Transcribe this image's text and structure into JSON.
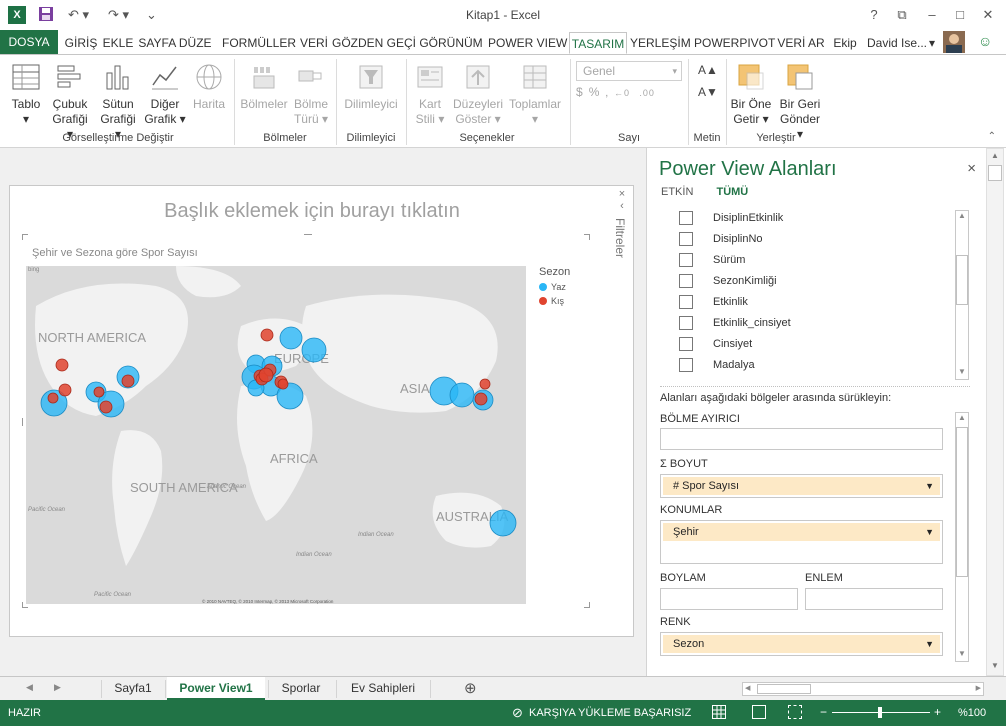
{
  "window": {
    "title": "Kitap1 - Excel",
    "help": "?",
    "minimize": "–",
    "restore": "□",
    "close": "✕",
    "ribbon_display": "⧉"
  },
  "ribbon_tabs": [
    "DOSYA",
    "GİRİŞ",
    "EKLE",
    "SAYFA DÜZE",
    "FORMÜLLER",
    "VERİ",
    "GÖZDEN GEÇİ",
    "GÖRÜNÜM",
    "POWER VIEW",
    "TASARIM",
    "YERLEŞİM",
    "POWERPIVOT",
    "VERİ AR",
    "Ekip"
  ],
  "user": {
    "name": "David Ise...",
    "chevron": "▾"
  },
  "ribbon": {
    "groups": {
      "visualization": "Görselleştirme Değiştir",
      "tiles": "Bölmeler",
      "slicer": "Dilimleyici",
      "options": "Seçenekler",
      "number": "Sayı",
      "text": "Metin",
      "arrange": "Yerleştir"
    },
    "buttons": {
      "table": [
        "Tablo",
        ""
      ],
      "bar": [
        "Çubuk",
        "Grafiği"
      ],
      "column": [
        "Sütun",
        "Grafiği"
      ],
      "other": [
        "Diğer",
        "Grafik"
      ],
      "map": [
        "Harita",
        ""
      ],
      "tiles": [
        "Bölmeler",
        ""
      ],
      "tile_type": [
        "Bölme",
        "Türü"
      ],
      "slicer": [
        "Dilimleyici",
        ""
      ],
      "card": [
        "Kart",
        "Stili"
      ],
      "show_levels": [
        "Düzeyleri",
        "Göster"
      ],
      "totals": [
        "Toplamlar",
        ""
      ],
      "bring_forward": [
        "Bir Öne",
        "Getir"
      ],
      "send_backward": [
        "Bir Geri",
        "Gönder"
      ]
    },
    "number_format": "Genel",
    "number_symbols": [
      "$",
      "%",
      "‚",
      "←0",
      ".00"
    ],
    "text_symbols": [
      "A▲",
      "A▼"
    ]
  },
  "canvas": {
    "title_placeholder": "Başlık eklemek için burayı tıklatın",
    "filters_label": "Filtreler",
    "filters_arrow": "‹",
    "filters_close": "×",
    "viz_title": "Şehir ve Sezona göre Spor Sayısı",
    "map_labels": {
      "na": "NORTH AMERICA",
      "eu": "EUROPE",
      "asia": "ASIA",
      "africa": "AFRICA",
      "sa": "SOUTH AMERICA",
      "au": "AUSTRALIA",
      "atlantic": "Atlantic Ocean",
      "pacific": "Pacific Ocean",
      "indian": "Indian Ocean",
      "indian2": "Indian Ocean",
      "pacific2": "Pacific Ocean",
      "bing": "bing",
      "copyright": "© 2010 NAVTEQ, © 2010 Intermap, © 2013 Microsoft Corporation"
    },
    "legend": {
      "title": "Sezon",
      "items": [
        {
          "label": "Yaz",
          "color": "#29b6f6"
        },
        {
          "label": "Kış",
          "color": "#e0442f"
        }
      ]
    }
  },
  "pane": {
    "title": "Power View Alanları",
    "close": "×",
    "tabs": [
      "ETKİN",
      "TÜMÜ"
    ],
    "fields": [
      "DisiplinEtkinlik",
      "DisiplinNo",
      "Sürüm",
      "SezonKimliği",
      "Etkinlik",
      "Etkinlik_cinsiyet",
      "Cinsiyet",
      "Madalya"
    ],
    "drag_hint": "Alanları aşağıdaki bölgeler arasında sürükleyin:",
    "zones": {
      "tile_by": "BÖLME AYIRICI",
      "size": "Σ BOYUT",
      "size_value": "# Spor Sayısı",
      "locations": "KONUMLAR",
      "locations_value": "Şehir",
      "longitude": "BOYLAM",
      "latitude": "ENLEM",
      "color": "RENK",
      "color_value": "Sezon"
    },
    "scroll_up": "▲",
    "scroll_down": "▼"
  },
  "sheets": [
    "Sayfa1",
    "Power View1",
    "Sporlar",
    "Ev Sahipleri"
  ],
  "sheet_nav": {
    "prev": "◀",
    "next": "▶",
    "add": "⊕"
  },
  "status": {
    "ready": "HAZIR",
    "upload": "KARŞIYA YÜKLEME BAŞARISIZ",
    "zoom": "%100",
    "zoom_minus": "−",
    "zoom_plus": "+"
  }
}
